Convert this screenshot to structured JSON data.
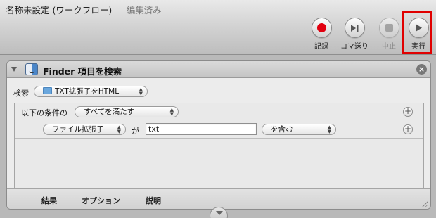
{
  "window": {
    "title": "名称未設定 (ワークフロー)",
    "status": "— 編集済み"
  },
  "toolbar": {
    "buttons": [
      {
        "label": "記録",
        "icon": "record-icon"
      },
      {
        "label": "コマ送り",
        "icon": "step-icon"
      },
      {
        "label": "中止",
        "icon": "stop-icon",
        "disabled": true
      },
      {
        "label": "実行",
        "icon": "play-icon",
        "highlighted": true
      }
    ]
  },
  "action": {
    "title": "Finder 項目を検索",
    "search_label": "検索",
    "search_location": "TXT拡張子をHTML",
    "condition_label": "以下の条件の",
    "condition_match": "すべてを満たす",
    "criteria": {
      "attribute": "ファイル拡張子",
      "particle": "が",
      "value": "txt",
      "operator": "を含む"
    },
    "footer_tabs": [
      "結果",
      "オプション",
      "説明"
    ]
  },
  "colors": {
    "record": "#e1000f",
    "highlight_border": "#e00000"
  }
}
